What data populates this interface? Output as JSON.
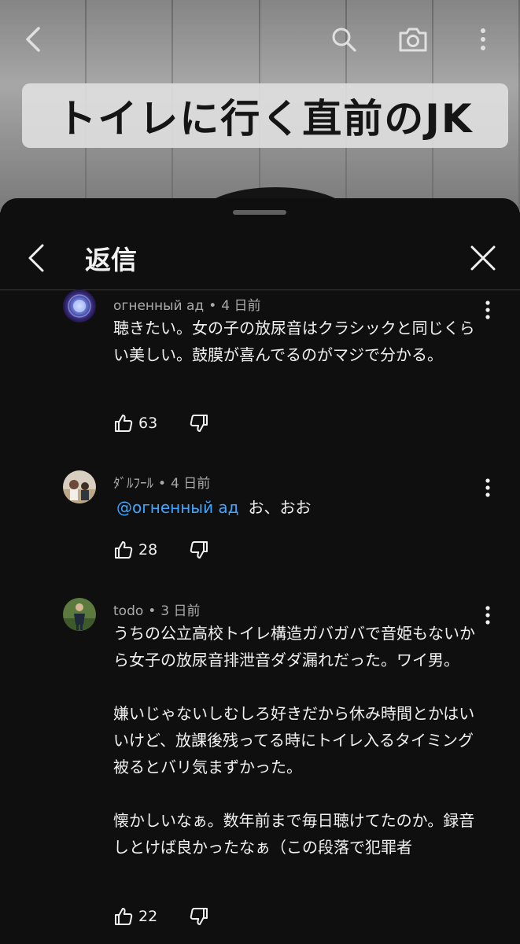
{
  "video": {
    "caption": "トイレに行く直前のJK"
  },
  "topbar": {
    "back_icon": "chevron-left-icon",
    "search_icon": "search-icon",
    "camera_icon": "camera-icon",
    "menu_icon": "more-vertical-icon"
  },
  "sheet": {
    "title": "返信"
  },
  "comments": [
    {
      "author": "огненный ад",
      "time": "4 日前",
      "text": "聴きたい。女の子の放尿音はクラシックと同じくらい美しい。鼓膜が喜んでるのがマジで分かる。",
      "likes": "63"
    },
    {
      "author": "ﾀﾞﾙﾌｰﾙ",
      "time": "4 日前",
      "mention": "@огненный ад",
      "text": "お、おお",
      "likes": "28"
    },
    {
      "author": "todo",
      "time": "3 日前",
      "text": "うちの公立高校トイレ構造ガバガバで音姫もないから女子の放尿音排泄音ダダ漏れだった。ワイ男。\n\n嫌いじゃないしむしろ好きだから休み時間とかはいいけど、放課後残ってる時にトイレ入るタイミング被るとバリ気まずかった。\n\n懐かしいなぁ。数年前まで毎日聴けてたのか。録音しとけば良かったなぁ（この段落で犯罪者",
      "likes": "22"
    }
  ]
}
